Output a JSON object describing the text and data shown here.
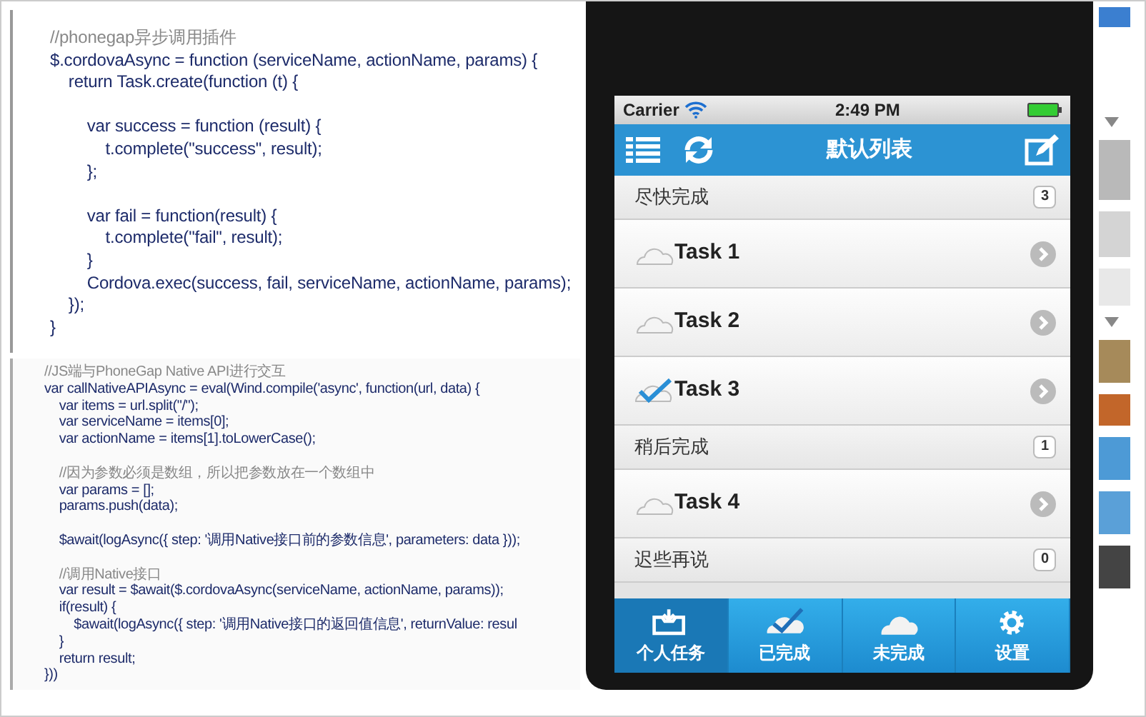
{
  "code_panels": [
    {
      "lines": [
        {
          "kind": "comment",
          "text": "//phonegap异步调用插件"
        },
        {
          "kind": "code",
          "text": "$.cordovaAsync = function (serviceName, actionName, params) {"
        },
        {
          "kind": "code",
          "text": "    return Task.create(function (t) {"
        },
        {
          "kind": "blank"
        },
        {
          "kind": "code",
          "text": "        var success = function (result) {"
        },
        {
          "kind": "code",
          "text": "            t.complete(\"success\", result);"
        },
        {
          "kind": "code",
          "text": "        };"
        },
        {
          "kind": "blank"
        },
        {
          "kind": "code",
          "text": "        var fail = function(result) {"
        },
        {
          "kind": "code",
          "text": "            t.complete(\"fail\", result);"
        },
        {
          "kind": "code",
          "text": "        }"
        },
        {
          "kind": "code",
          "text": "        Cordova.exec(success, fail, serviceName, actionName, params);"
        },
        {
          "kind": "code",
          "text": "    });"
        },
        {
          "kind": "code",
          "text": "}"
        }
      ]
    },
    {
      "lines": [
        {
          "kind": "comment",
          "text": "//JS端与PhoneGap Native API进行交互"
        },
        {
          "kind": "code",
          "text": "var callNativeAPIAsync = eval(Wind.compile('async', function(url, data) {"
        },
        {
          "kind": "code",
          "text": "    var items = url.split(\"/\");"
        },
        {
          "kind": "code",
          "text": "    var serviceName = items[0];"
        },
        {
          "kind": "code",
          "text": "    var actionName = items[1].toLowerCase();"
        },
        {
          "kind": "blank"
        },
        {
          "kind": "comment",
          "text": "    //因为参数必须是数组，所以把参数放在一个数组中"
        },
        {
          "kind": "code",
          "text": "    var params = [];"
        },
        {
          "kind": "code",
          "text": "    params.push(data);"
        },
        {
          "kind": "blank"
        },
        {
          "kind": "code",
          "text": "    $await(logAsync({ step: '调用Native接口前的参数信息', parameters: data }));"
        },
        {
          "kind": "blank"
        },
        {
          "kind": "comment",
          "text": "    //调用Native接口"
        },
        {
          "kind": "code",
          "text": "    var result = $await($.cordovaAsync(serviceName, actionName, params));"
        },
        {
          "kind": "code",
          "text": "    if(result) {"
        },
        {
          "kind": "code",
          "text": "        $await(logAsync({ step: '调用Native接口的返回值信息', returnValue: resul"
        },
        {
          "kind": "code",
          "text": "    }"
        },
        {
          "kind": "code",
          "text": "    return result;"
        },
        {
          "kind": "code",
          "text": "}))"
        }
      ]
    }
  ],
  "phone": {
    "status_bar": {
      "carrier": "Carrier",
      "time": "2:49 PM"
    },
    "header": {
      "title": "默认列表"
    },
    "groups": [
      {
        "title": "尽快完成",
        "count": "3",
        "tasks": [
          {
            "title": "Task 1",
            "done": false
          },
          {
            "title": "Task 2",
            "done": false
          },
          {
            "title": "Task 3",
            "done": true
          }
        ]
      },
      {
        "title": "稍后完成",
        "count": "1",
        "tasks": [
          {
            "title": "Task 4",
            "done": false
          }
        ]
      },
      {
        "title": "迟些再说",
        "count": "0"
      }
    ],
    "tab_bar": [
      {
        "label": "个人任务",
        "kind": "inbox",
        "selected": true
      },
      {
        "label": "已完成",
        "kind": "done",
        "selected": false
      },
      {
        "label": "未完成",
        "kind": "todo",
        "selected": false
      },
      {
        "label": "设置",
        "kind": "settings",
        "selected": false
      }
    ]
  }
}
